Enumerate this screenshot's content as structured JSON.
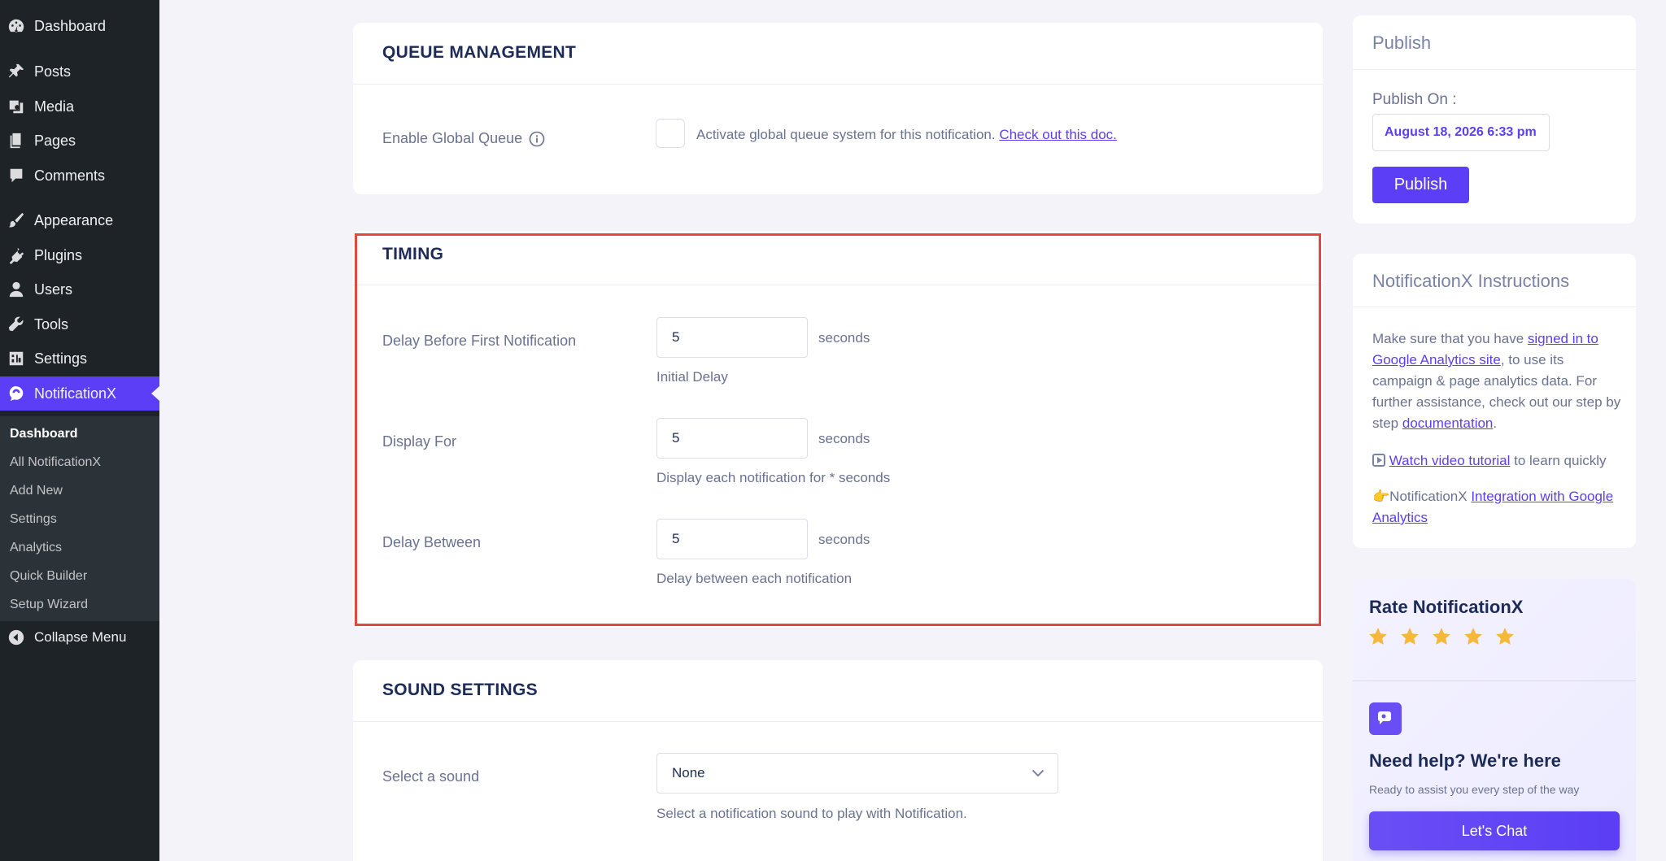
{
  "sidebar": {
    "menu": [
      {
        "label": "Dashboard",
        "icon": "dashboard-icon"
      },
      {
        "label": "Posts",
        "icon": "pin-icon"
      },
      {
        "label": "Media",
        "icon": "media-icon"
      },
      {
        "label": "Pages",
        "icon": "pages-icon"
      },
      {
        "label": "Comments",
        "icon": "comment-icon"
      },
      {
        "label": "Appearance",
        "icon": "brush-icon"
      },
      {
        "label": "Plugins",
        "icon": "plug-icon"
      },
      {
        "label": "Users",
        "icon": "user-icon"
      },
      {
        "label": "Tools",
        "icon": "wrench-icon"
      },
      {
        "label": "Settings",
        "icon": "settings-icon"
      },
      {
        "label": "NotificationX",
        "icon": "notificationx-icon"
      }
    ],
    "submenu": [
      "Dashboard",
      "All NotificationX",
      "Add New",
      "Settings",
      "Analytics",
      "Quick Builder",
      "Setup Wizard"
    ],
    "collapse_label": "Collapse Menu"
  },
  "queue": {
    "title": "QUEUE MANAGEMENT",
    "label": "Enable Global Queue",
    "desc": "Activate global queue system for this notification.",
    "link": "Check out this doc."
  },
  "timing": {
    "title": "TIMING",
    "fields": [
      {
        "label": "Delay Before First Notification",
        "value": "5",
        "suffix": "seconds",
        "help": "Initial Delay"
      },
      {
        "label": "Display For",
        "value": "5",
        "suffix": "seconds",
        "help": "Display each notification for * seconds"
      },
      {
        "label": "Delay Between",
        "value": "5",
        "suffix": "seconds",
        "help": "Delay between each notification"
      }
    ]
  },
  "sound": {
    "title": "SOUND SETTINGS",
    "label": "Select a sound",
    "selected": "None",
    "help": "Select a notification sound to play with Notification."
  },
  "publish": {
    "title": "Publish",
    "on_label": "Publish On :",
    "date": "August 18, 2026 6:33 pm",
    "button": "Publish"
  },
  "instructions": {
    "title": "NotificationX Instructions",
    "p1_a": "Make sure that you have ",
    "p1_link1": "signed in to Google Analytics site",
    "p1_b": ", to use its campaign & page analytics data. For further assistance, check out our step by step ",
    "p1_link2": "documentation",
    "p1_c": ".",
    "p2_link": "Watch video tutorial",
    "p2_rest": " to learn quickly",
    "p3_prefix": "👉NotificationX ",
    "p3_link": "Integration with Google Analytics"
  },
  "rate": {
    "title": "Rate NotificationX",
    "stars": 5,
    "help_title": "Need help? We're here",
    "help_sub": "Ready to assist you every step of the way",
    "chat_button": "Let's Chat"
  },
  "colors": {
    "accent": "#5b3ef5",
    "sidebar_bg": "#1d2327",
    "highlight": "#e5483a",
    "star": "#f6b83a"
  }
}
